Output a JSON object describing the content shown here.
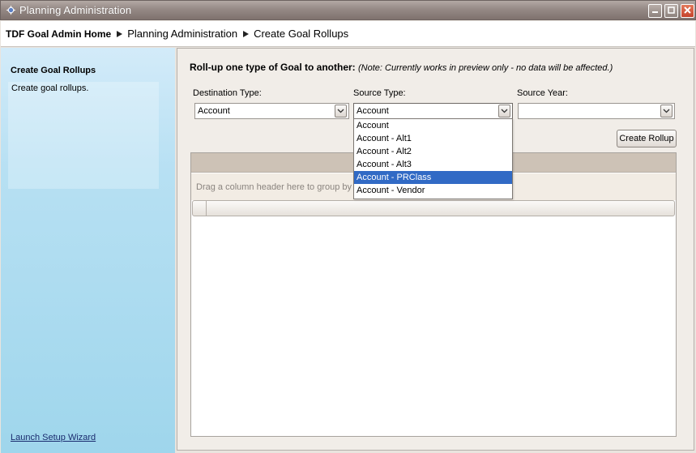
{
  "window": {
    "title": "Planning Administration",
    "icon": "gear-app-icon",
    "controls": [
      "minimize-icon",
      "maximize-icon",
      "close-icon"
    ]
  },
  "breadcrumb": {
    "home": "TDF Goal Admin Home",
    "items": [
      "Planning Administration",
      "Create Goal Rollups"
    ]
  },
  "sidebar": {
    "title": "Create Goal Rollups",
    "description": "Create goal rollups.",
    "wizard_link": "Launch Setup Wizard"
  },
  "main": {
    "headline_bold": "Roll-up one type of Goal to another:",
    "headline_note": "(Note: Currently works in preview only - no data will be affected.)",
    "destination": {
      "label": "Destination Type:",
      "value": "Account"
    },
    "source": {
      "label": "Source Type:",
      "value": "Account"
    },
    "year": {
      "label": "Source Year:",
      "value": ""
    },
    "create_button": "Create Rollup",
    "grid": {
      "group_hint": "Drag a column header here to group by t"
    },
    "source_dropdown": {
      "options": [
        "Account",
        "Account - Alt1",
        "Account - Alt2",
        "Account - Alt3",
        "Account - PRClass",
        "Account - Vendor"
      ],
      "highlighted": "Account - PRClass"
    }
  },
  "colors": {
    "selection": "#316ac5",
    "titlebar": "#958985",
    "sidebar": "#b7e0f3"
  }
}
